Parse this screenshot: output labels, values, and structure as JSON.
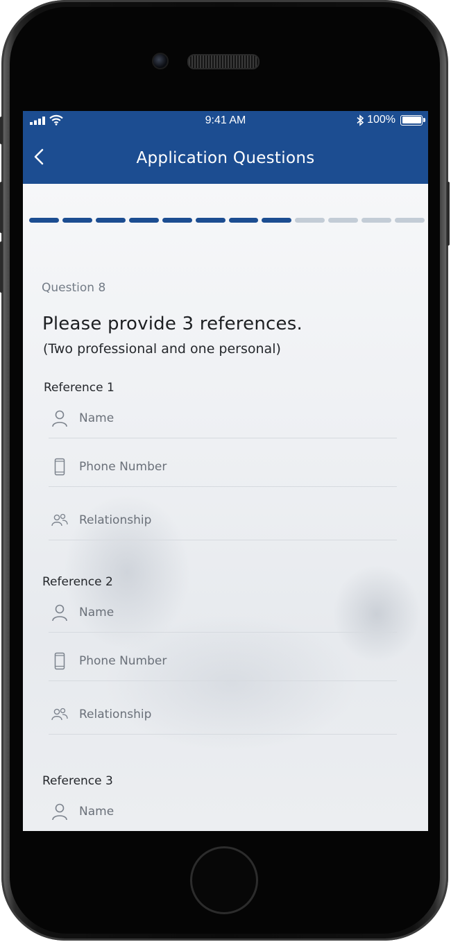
{
  "status_bar": {
    "time": "9:41 AM",
    "battery": "100%",
    "icons": [
      "signal-icon",
      "wifi-icon",
      "bluetooth-icon",
      "battery-icon"
    ]
  },
  "nav": {
    "title": "Application Questions",
    "back_icon": "chevron-left-icon"
  },
  "progress": {
    "total_steps": 12,
    "completed_steps": 8
  },
  "question": {
    "number_label": "Question 8",
    "text": "Please provide 3 references.",
    "subtext": "(Two professional and one personal)"
  },
  "references": [
    {
      "title": "Reference 1",
      "fields": [
        {
          "icon": "person-icon",
          "placeholder": "Name",
          "value": ""
        },
        {
          "icon": "phone-icon",
          "placeholder": "Phone Number",
          "value": ""
        },
        {
          "icon": "people-icon",
          "placeholder": "Relationship",
          "value": ""
        }
      ]
    },
    {
      "title": "Reference 2",
      "fields": [
        {
          "icon": "person-icon",
          "placeholder": "Name",
          "value": ""
        },
        {
          "icon": "phone-icon",
          "placeholder": "Phone Number",
          "value": ""
        },
        {
          "icon": "people-icon",
          "placeholder": "Relationship",
          "value": ""
        }
      ]
    },
    {
      "title": "Reference 3",
      "fields": [
        {
          "icon": "person-icon",
          "placeholder": "Name",
          "value": ""
        }
      ]
    }
  ],
  "colors": {
    "brand": "#1c4d91",
    "progress_inactive": "#c3ccd6",
    "muted_text": "#737b86"
  }
}
